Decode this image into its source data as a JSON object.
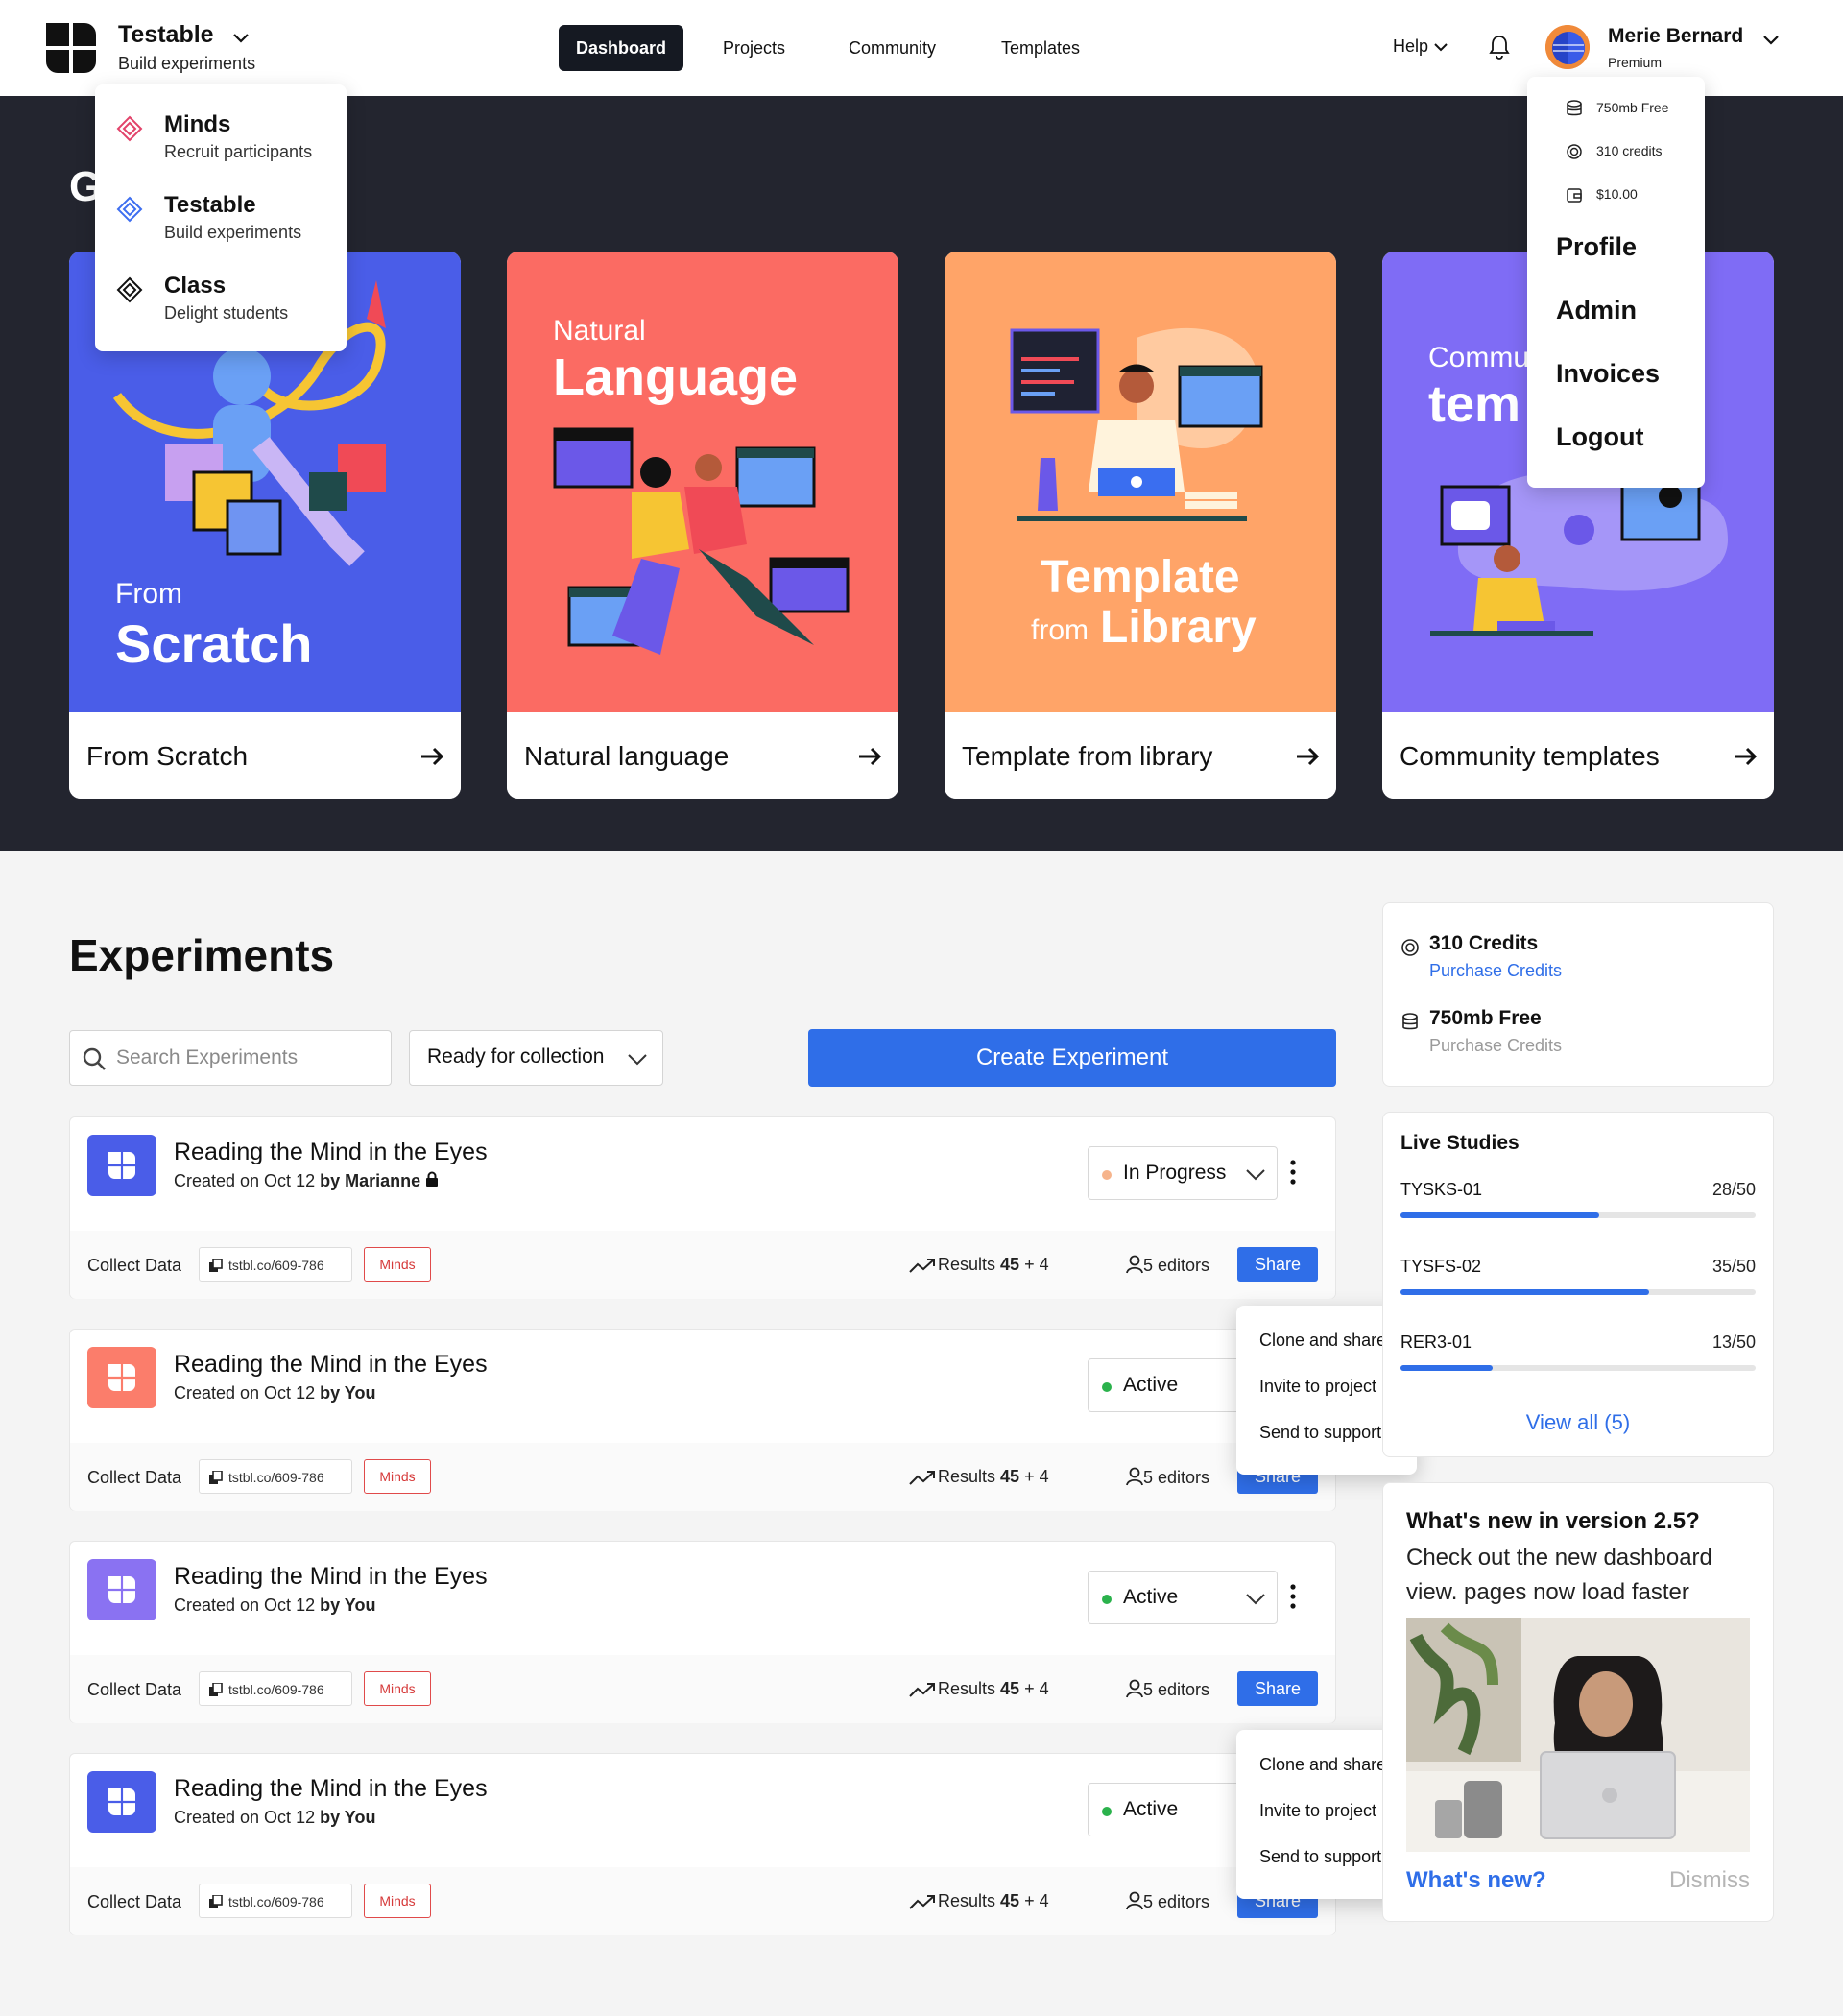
{
  "header": {
    "brand": {
      "name": "Testable",
      "subtitle": "Build experiments"
    },
    "nav": [
      {
        "label": "Dashboard",
        "active": true
      },
      {
        "label": "Projects"
      },
      {
        "label": "Community"
      },
      {
        "label": "Templates"
      }
    ],
    "help": "Help",
    "user": {
      "name": "Merie Bernard",
      "plan": "Premium"
    }
  },
  "app_menu": [
    {
      "title": "Minds",
      "subtitle": "Recruit participants",
      "icon": "minds-diamond-icon",
      "color": "#e2436a"
    },
    {
      "title": "Testable",
      "subtitle": "Build experiments",
      "icon": "testable-diamond-icon",
      "color": "#3d6ef0"
    },
    {
      "title": "Class",
      "subtitle": "Delight students",
      "icon": "class-diamond-icon",
      "color": "#111111"
    }
  ],
  "user_menu": {
    "stats": [
      "750mb Free",
      "310 credits",
      "$10.00"
    ],
    "links": [
      "Profile",
      "Admin",
      "Invoices",
      "Logout"
    ]
  },
  "hero": {
    "title": "G",
    "cards": [
      {
        "art_small": "From",
        "art_big": "Scratch",
        "label": "From Scratch",
        "bg": "#4a5de8"
      },
      {
        "art_small": "Natural",
        "art_big": "Language",
        "label": "Natural language",
        "bg": "#fb6b63"
      },
      {
        "art_line1": "Template",
        "art_from": "from",
        "art_library": "Library",
        "label": "Template from library",
        "bg": "#ffa468"
      },
      {
        "art_small": "Commu",
        "art_big": "tem",
        "label": "Community templates",
        "bg": "#7f6cf5"
      }
    ]
  },
  "experiments": {
    "title": "Experiments",
    "search_placeholder": "Search Experiments",
    "filter": "Ready for collection",
    "create": "Create Experiment",
    "items": [
      {
        "name": "Reading the Mind in the Eyes",
        "created": "Created on Oct 12",
        "by": "by Marianne",
        "status": "In Progress",
        "status_color": "#f6b48c",
        "icon_bg": "#4a5de8",
        "collect": "Collect Data",
        "link": "tstbl.co/609-786",
        "tag": "Minds",
        "results_label": "Results",
        "results": "45",
        "results_extra": "+ 4",
        "editors": "5 editors",
        "share": "Share"
      },
      {
        "name": "Reading the Mind in the Eyes",
        "created": "Created on Oct 12",
        "by": "by You",
        "status": "Active",
        "status_color": "#2bb24c",
        "icon_bg": "#fb7d6b",
        "collect": "Collect Data",
        "link": "tstbl.co/609-786",
        "tag": "Minds",
        "results_label": "Results",
        "results": "45",
        "results_extra": "+ 4",
        "editors": "5 editors",
        "share": "Share"
      },
      {
        "name": "Reading the Mind in the Eyes",
        "created": "Created on Oct 12",
        "by": "by You",
        "status": "Active",
        "status_color": "#2bb24c",
        "icon_bg": "#8a72f2",
        "collect": "Collect Data",
        "link": "tstbl.co/609-786",
        "tag": "Minds",
        "results_label": "Results",
        "results": "45",
        "results_extra": "+ 4",
        "editors": "5 editors",
        "share": "Share"
      },
      {
        "name": "Reading the Mind in the Eyes",
        "created": "Created on Oct 12",
        "by": "by You",
        "status": "Active",
        "status_color": "#2bb24c",
        "icon_bg": "#4a5de8",
        "collect": "Collect Data",
        "link": "tstbl.co/609-786",
        "tag": "Minds",
        "results_label": "Results",
        "results": "45",
        "results_extra": "+ 4",
        "editors": "5 editors",
        "share": "Share"
      }
    ],
    "context_menu": [
      "Clone and share",
      "Invite to project",
      "Send to support"
    ]
  },
  "sidebar": {
    "credits": {
      "title": "310 Credits",
      "link": "Purchase Credits"
    },
    "storage": {
      "title": "750mb Free",
      "link": "Purchase Credits"
    },
    "live": {
      "title": "Live Studies",
      "studies": [
        {
          "name": "TYSKS-01",
          "count": "28/50",
          "progress": 0.56
        },
        {
          "name": "TYSFS-02",
          "count": "35/50",
          "progress": 0.7
        },
        {
          "name": "RER3-01",
          "count": "13/50",
          "progress": 0.26
        }
      ],
      "view_all": "View all (5)"
    },
    "news": {
      "title": "What's new in version 2.5?",
      "desc": "Check out the new dashboard view. pages now load faster",
      "link": "What's new?",
      "dismiss": "Dismiss"
    }
  }
}
